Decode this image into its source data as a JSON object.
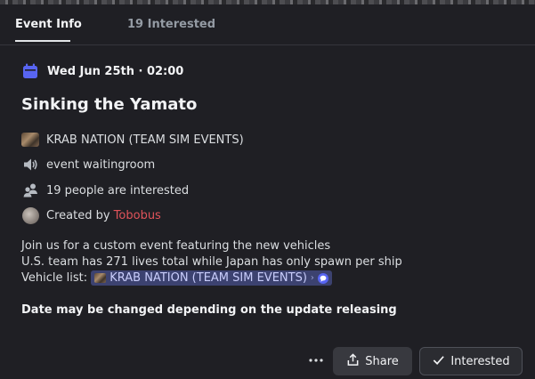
{
  "tabs": {
    "event_info": "Event Info",
    "interested": "19 Interested"
  },
  "event": {
    "date": "Wed Jun 25th · 02:00",
    "title": "Sinking the Yamato",
    "server": "KRAB NATION (TEAM SIM EVENTS)",
    "channel": "event waitingroom",
    "interested_count": "19 people are interested",
    "created_by_label": "Created by ",
    "creator": "Tobobus"
  },
  "description": {
    "line1": "Join us for a custom event featuring the new vehicles",
    "line2": "U.S. team has 271 lives total while Japan has only spawn per ship",
    "line3_prefix": "Vehicle list: ",
    "chip_server": "KRAB NATION (TEAM SIM EVENTS)",
    "notice": "Date may be changed depending on the update releasing"
  },
  "actions": {
    "more": "···",
    "share": "Share",
    "interested": "Interested"
  },
  "icons": {
    "calendar": "calendar-icon",
    "speaker": "speaker-icon",
    "people": "people-icon",
    "share": "share-icon",
    "check": "checkmark-icon",
    "chat": "chat-bubble-icon"
  },
  "colors": {
    "accent": "#5865f2",
    "creator": "#e0535a",
    "chip_bg": "#3c4270"
  }
}
